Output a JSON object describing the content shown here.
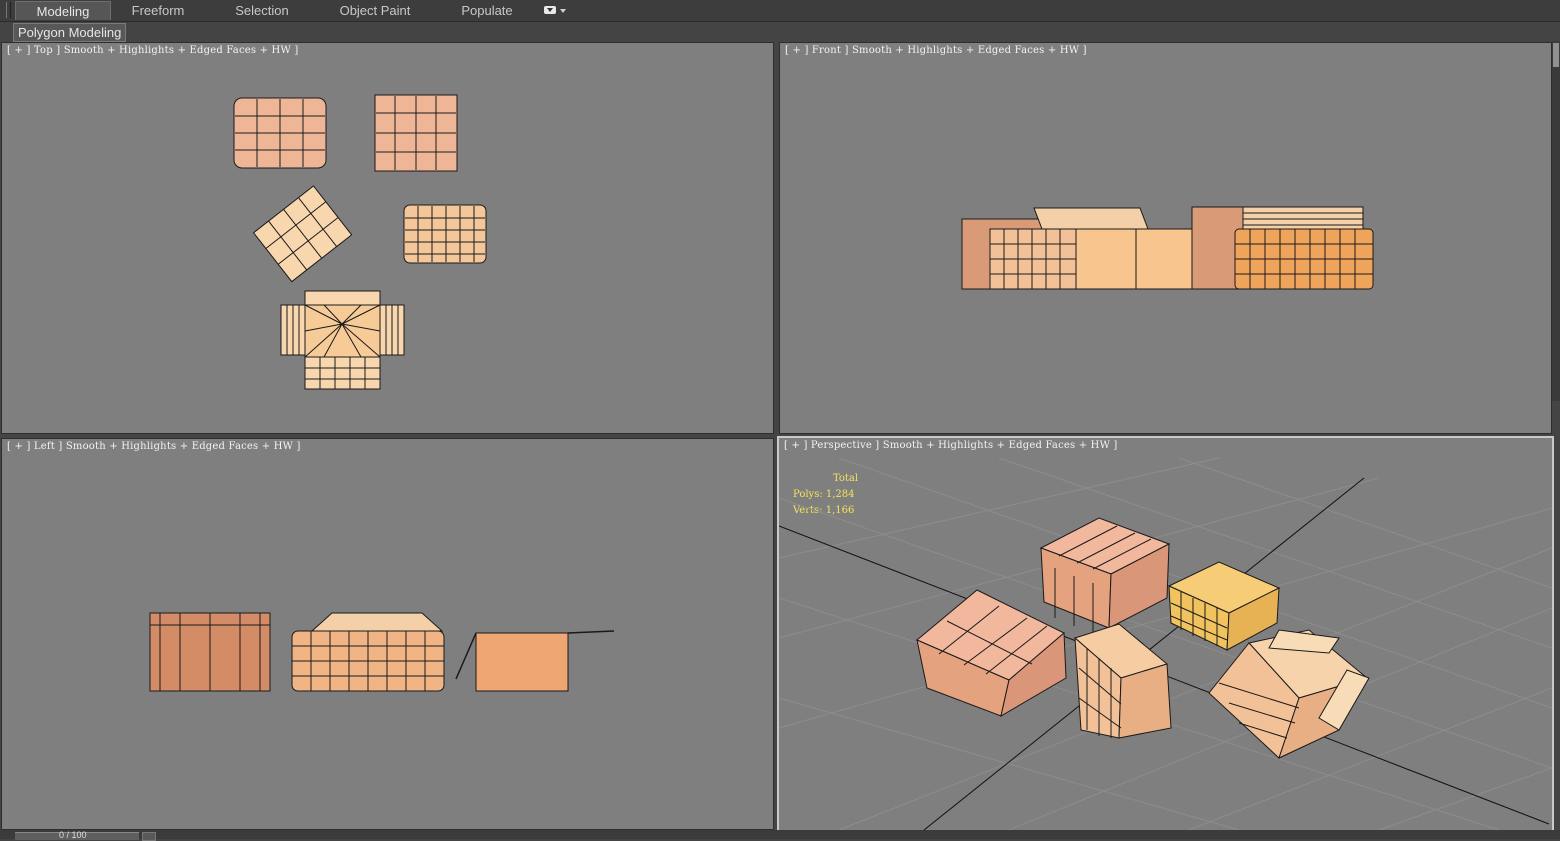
{
  "ribbon": {
    "tabs": [
      {
        "label": "Modeling",
        "active": true
      },
      {
        "label": "Freeform",
        "active": false
      },
      {
        "label": "Selection",
        "active": false
      },
      {
        "label": "Object Paint",
        "active": false
      },
      {
        "label": "Populate",
        "active": false
      }
    ],
    "options_icon": "ribbon-options-icon"
  },
  "panel": {
    "label": "Polygon Modeling"
  },
  "viewports": {
    "top": {
      "label": "[ + ] Top ] Smooth + Highlights + Edged Faces + HW ]"
    },
    "front": {
      "label": "[ + ] Front ] Smooth + Highlights + Edged Faces + HW ]"
    },
    "left": {
      "label": "[ + ] Left ] Smooth + Highlights + Edged Faces + HW ]"
    },
    "perspective": {
      "label": "[ + ] Perspective ] Smooth + Highlights + Edged Faces + HW ]"
    }
  },
  "stats": {
    "title": "Total",
    "polys": "Polys: 1,284",
    "verts": "Verts: 1,166"
  },
  "statusbar": {
    "time_text": "0 / 100"
  },
  "colors": {
    "viewport_bg": "#7f7f7f",
    "box_fill": "#e8b08a",
    "box_fill_light": "#f6d1a6",
    "box_fill_orange": "#efa45b",
    "stats_text": "#f5e25a"
  }
}
